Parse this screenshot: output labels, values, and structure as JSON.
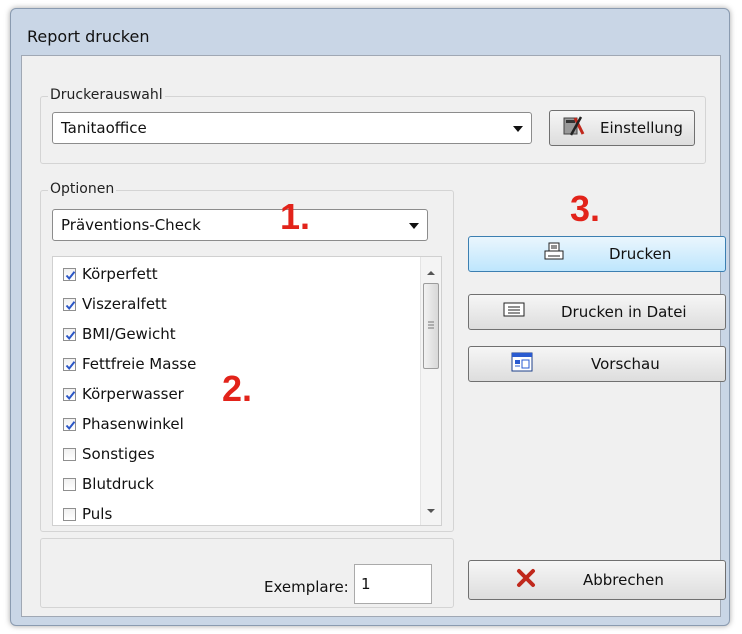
{
  "window": {
    "title": "Report drucken"
  },
  "printer": {
    "group_label": "Druckerauswahl",
    "selected": "Tanitaoffice",
    "settings_label": "Einstellung"
  },
  "options": {
    "group_label": "Optionen",
    "selected": "Präventions-Check",
    "items": [
      {
        "label": "Körperfett",
        "checked": true
      },
      {
        "label": "Viszeralfett",
        "checked": true
      },
      {
        "label": "BMI/Gewicht",
        "checked": true
      },
      {
        "label": "Fettfreie Masse",
        "checked": true
      },
      {
        "label": "Körperwasser",
        "checked": true
      },
      {
        "label": "Phasenwinkel",
        "checked": true
      },
      {
        "label": "Sonstiges",
        "checked": false
      },
      {
        "label": "Blutdruck",
        "checked": false
      },
      {
        "label": "Puls",
        "checked": false
      }
    ]
  },
  "copies": {
    "label": "Exemplare:",
    "value": "1"
  },
  "buttons": {
    "print": "Drucken",
    "print_to_file": "Drucken in Datei",
    "preview": "Vorschau",
    "cancel": "Abbrechen"
  },
  "annotations": {
    "step1": "1.",
    "step2": "2.",
    "step3": "3."
  },
  "colors": {
    "annotation": "#e2231a",
    "checkmark": "#2b56c6",
    "cancel_icon": "#c0281c"
  }
}
